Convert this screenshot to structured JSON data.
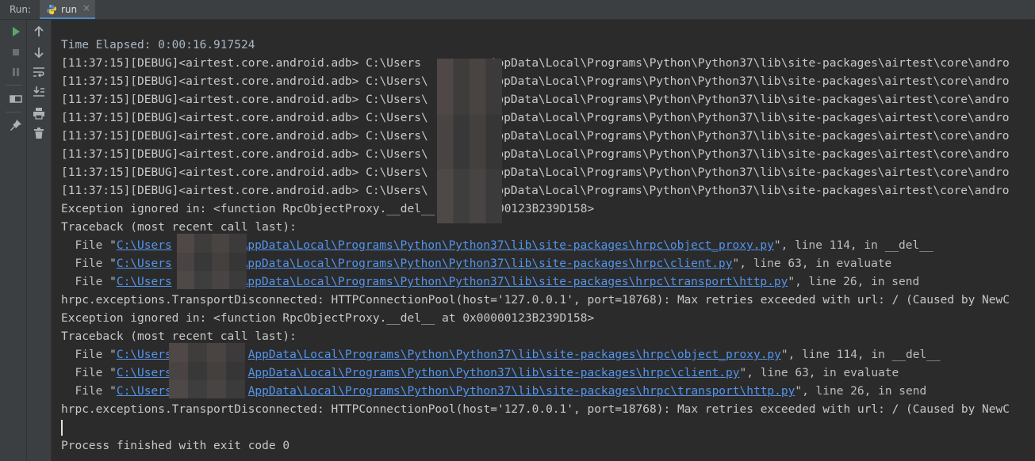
{
  "tabbar": {
    "run_label": "Run:",
    "tab_label": "run",
    "tab_icon": "python-icon",
    "close_glyph": "×"
  },
  "toolbar": {
    "rerun_icon": "run-icon",
    "stop_icon": "stop-icon",
    "pause_icon": "pause-icon",
    "layout_icon": "layout-icon",
    "pin_icon": "pin-icon",
    "up_icon": "arrow-up-icon",
    "down_icon": "arrow-down-icon",
    "wrap_icon": "soft-wrap-icon",
    "scroll_icon": "scroll-to-end-icon",
    "print_icon": "print-icon",
    "trash_icon": "trash-icon"
  },
  "console": {
    "elapsed": "Time Elapsed: 0:00:16.917524",
    "debug_prefix": "[11:37:15][DEBUG]<airtest.core.android.adb> C:\\Users",
    "debug_suffix": "AppData\\Local\\Programs\\Python\\Python37\\lib\\site-packages\\airtest\\core\\andro",
    "debug_seps": [
      "",
      "\\",
      "\\",
      "\\",
      "\\",
      "\\",
      "\\",
      "\\"
    ],
    "exception_line": "Exception ignored in: <function RpcObjectProxy.__del__ at 0x00000123B239D158>",
    "traceback_line": "Traceback (most recent call last):",
    "file_prefix": "  File \"",
    "frames": [
      {
        "path_start": "C:\\Users",
        "path_end": "AppData\\Local\\Programs\\Python\\Python37\\lib\\site-packages\\hrpc\\object_proxy.py",
        "tail": "\", line 114, in __del__"
      },
      {
        "path_start": "C:\\Users",
        "path_end": "AppData\\Local\\Programs\\Python\\Python37\\lib\\site-packages\\hrpc\\client.py",
        "tail": "\", line 63, in evaluate"
      },
      {
        "path_start": "C:\\Users",
        "path_end": "AppData\\Local\\Programs\\Python\\Python37\\lib\\site-packages\\hrpc\\transport\\http.py",
        "tail": "\", line 26, in send"
      }
    ],
    "error_line": "hrpc.exceptions.TransportDisconnected: HTTPConnectionPool(host='127.0.0.1', port=18768): Max retries exceeded with url: / (Caused by NewC",
    "exit_line": "Process finished with exit code 0"
  },
  "colors": {
    "background": "#2b2b2b",
    "panel": "#3c3f41",
    "link": "#5394ec",
    "run_green": "#59a869"
  }
}
